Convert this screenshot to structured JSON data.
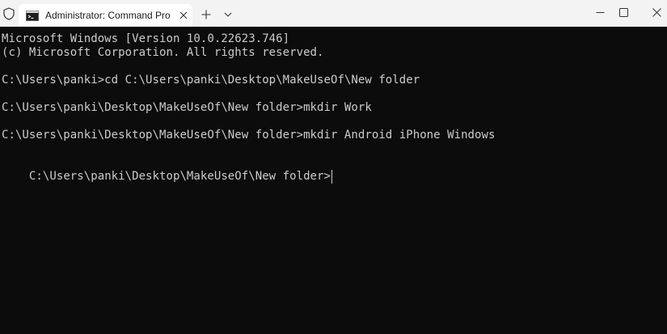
{
  "window": {
    "tab_title": "Administrator: Command Pro",
    "new_tab": "+",
    "dropdown": "⌄",
    "tab_close": "✕",
    "min": "—",
    "max": "☐",
    "close": "✕"
  },
  "console": {
    "lines": [
      "Microsoft Windows [Version 10.0.22623.746]",
      "(c) Microsoft Corporation. All rights reserved.",
      "",
      "C:\\Users\\panki>cd C:\\Users\\panki\\Desktop\\MakeUseOf\\New folder",
      "",
      "C:\\Users\\panki\\Desktop\\MakeUseOf\\New folder>mkdir Work",
      "",
      "C:\\Users\\panki\\Desktop\\MakeUseOf\\New folder>mkdir Android iPhone Windows",
      "",
      "C:\\Users\\panki\\Desktop\\MakeUseOf\\New folder>"
    ]
  },
  "icons": {
    "shield": "shield-icon",
    "terminal": "terminal-icon",
    "close": "close-icon",
    "plus": "plus-icon",
    "chevron": "chevron-down-icon",
    "minimize": "minimize-icon",
    "maximize": "maximize-icon",
    "window_close": "window-close-icon"
  },
  "colors": {
    "titlebar": "#f3f3f3",
    "tab": "#ffffff",
    "console_bg": "#0c0c0c",
    "console_text": "#cccccc"
  }
}
